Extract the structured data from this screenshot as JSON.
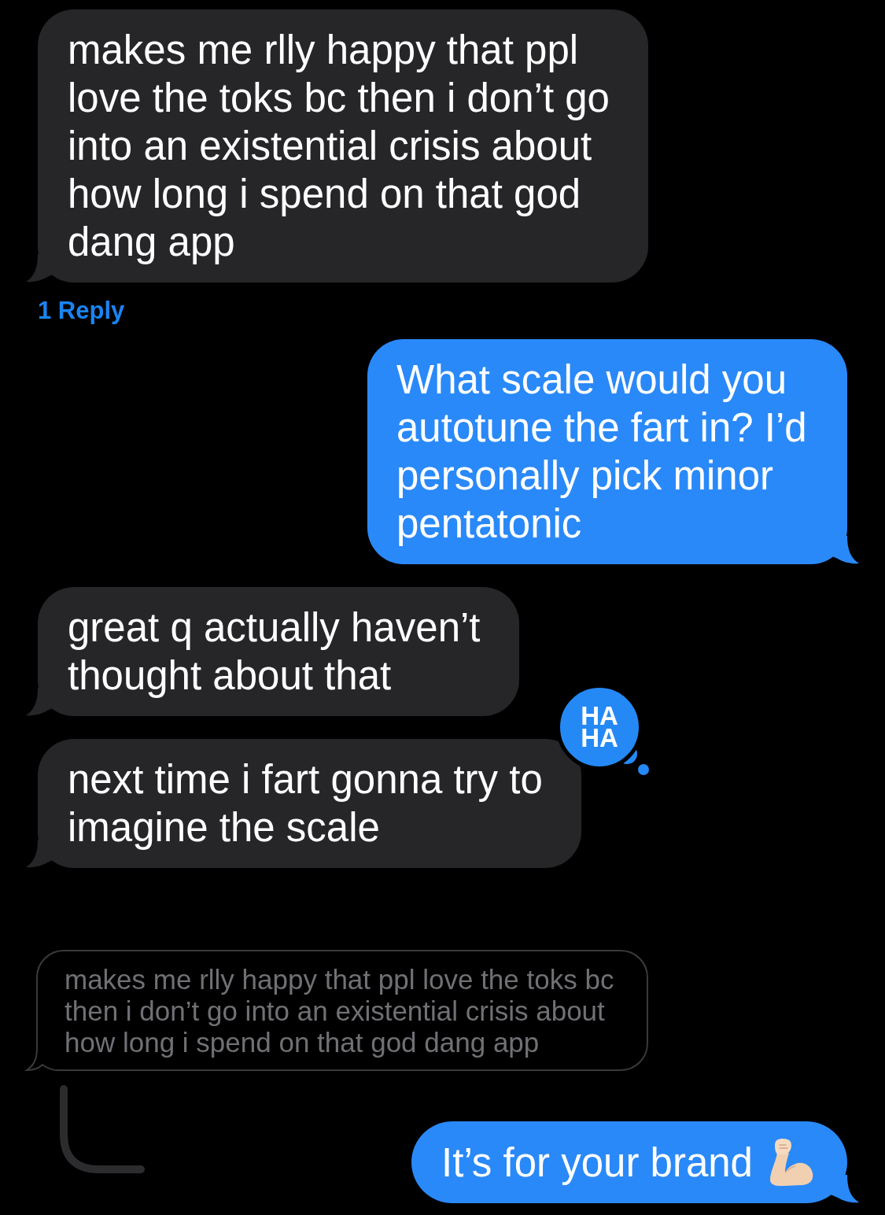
{
  "thread": [
    {
      "kind": "incoming",
      "text": "makes me rlly happy that ppl love the toks bc then i don’t go into an existential crisis about how long i spend on that god dang app",
      "replies": "1 Reply"
    },
    {
      "kind": "outgoing",
      "text": "What scale would you autotune the fart in? I’d personally pick minor pentatonic"
    },
    {
      "kind": "incoming",
      "text": "great q actually haven’t thought about that"
    },
    {
      "kind": "incoming",
      "text": "next time i fart gonna try to imagine the scale",
      "tapback": {
        "label": "HA HA"
      }
    },
    {
      "kind": "quoted",
      "text": "makes me rlly happy that ppl love the toks bc then i don’t go into an existential crisis about how long i spend on that god dang app"
    },
    {
      "kind": "reply_outgoing",
      "text": "It’s for your brand",
      "emoji": true
    }
  ]
}
